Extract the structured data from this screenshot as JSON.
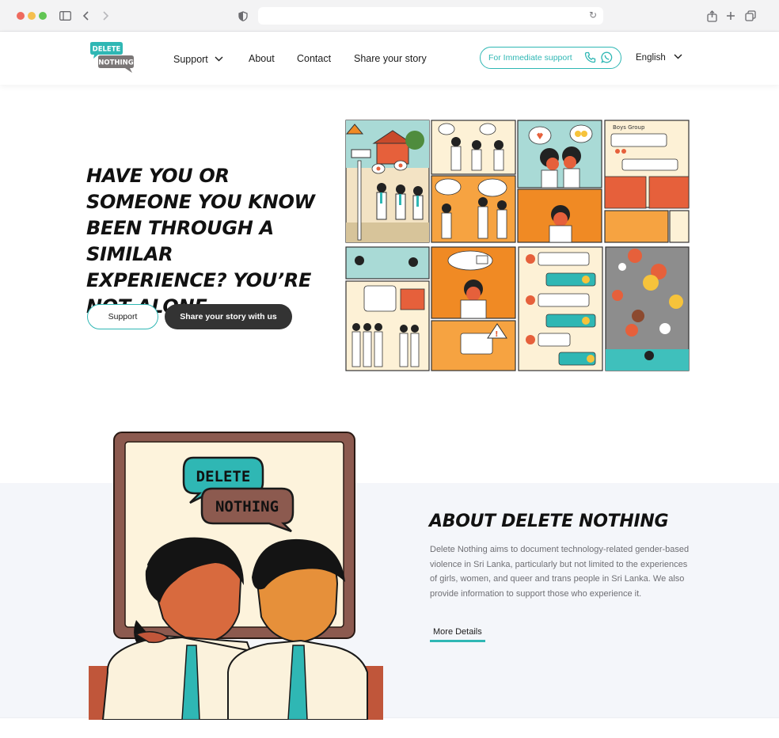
{
  "browser": {
    "url": ""
  },
  "header": {
    "logo_line1": "DELETE",
    "logo_line2": "NOTHING",
    "nav": [
      {
        "label": "Support"
      },
      {
        "label": "About"
      },
      {
        "label": "Contact"
      },
      {
        "label": "Share your story"
      }
    ],
    "immediate_support": "For Immediate support",
    "language": "English"
  },
  "hero": {
    "title": "Have you or someone you know been through a similar experience? You’re not alone.",
    "support_button": "Support",
    "share_button": "Share your story with us",
    "comic": {
      "group_chat_title": "Boys Group"
    }
  },
  "about": {
    "title": "About Delete Nothing",
    "description": "Delete Nothing aims to document technology-related gender-based violence in Sri Lanka, particularly but not limited to the experiences of girls, women, and queer and trans people in Sri Lanka. We also provide information to support those who experience it.",
    "more_link": "More Details",
    "illustration_line1": "DELETE",
    "illustration_line2": "NOTHING"
  },
  "colors": {
    "teal": "#2fb7b4",
    "dark_button": "#333333",
    "orange": "#f08a24",
    "brown_frame": "#8c5a4f"
  }
}
